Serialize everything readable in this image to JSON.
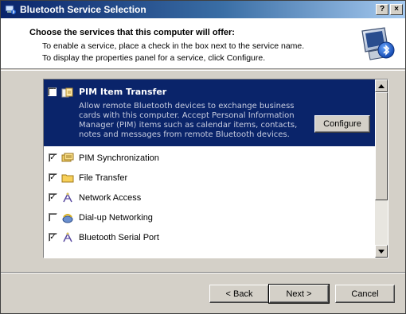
{
  "window": {
    "title": "Bluetooth Service Selection",
    "help_glyph": "?",
    "close_glyph": "×"
  },
  "header": {
    "title": "Choose the services that this computer will offer:",
    "line1": "To enable a service, place a check in the box next to the service name.",
    "line2": "To display the properties panel for a service, click Configure.",
    "graphic_icon": "bluetooth-computer-icon"
  },
  "services": {
    "selected": {
      "label": "PIM Item Transfer",
      "checked": true,
      "icon": "pim-transfer-icon",
      "description": "Allow remote Bluetooth devices to exchange business cards with this computer. Accept Personal Information Manager (PIM) items such as calendar items, contacts, notes and messages from remote Bluetooth devices.",
      "configure_label": "Configure"
    },
    "items": [
      {
        "label": "PIM Synchronization",
        "checked": true,
        "icon": "sync-folder-icon"
      },
      {
        "label": "File Transfer",
        "checked": true,
        "icon": "folder-icon"
      },
      {
        "label": "Network Access",
        "checked": true,
        "icon": "network-access-icon"
      },
      {
        "label": "Dial-up Networking",
        "checked": false,
        "icon": "dialup-icon"
      },
      {
        "label": "Bluetooth Serial Port",
        "checked": true,
        "icon": "serial-port-icon"
      }
    ]
  },
  "footer": {
    "back_label": "< Back",
    "next_label": "Next >",
    "cancel_label": "Cancel"
  },
  "colors": {
    "selection": "#0a246a",
    "title_bar_start": "#0a246a",
    "title_bar_end": "#a6caf0",
    "face": "#d4d0c8"
  }
}
